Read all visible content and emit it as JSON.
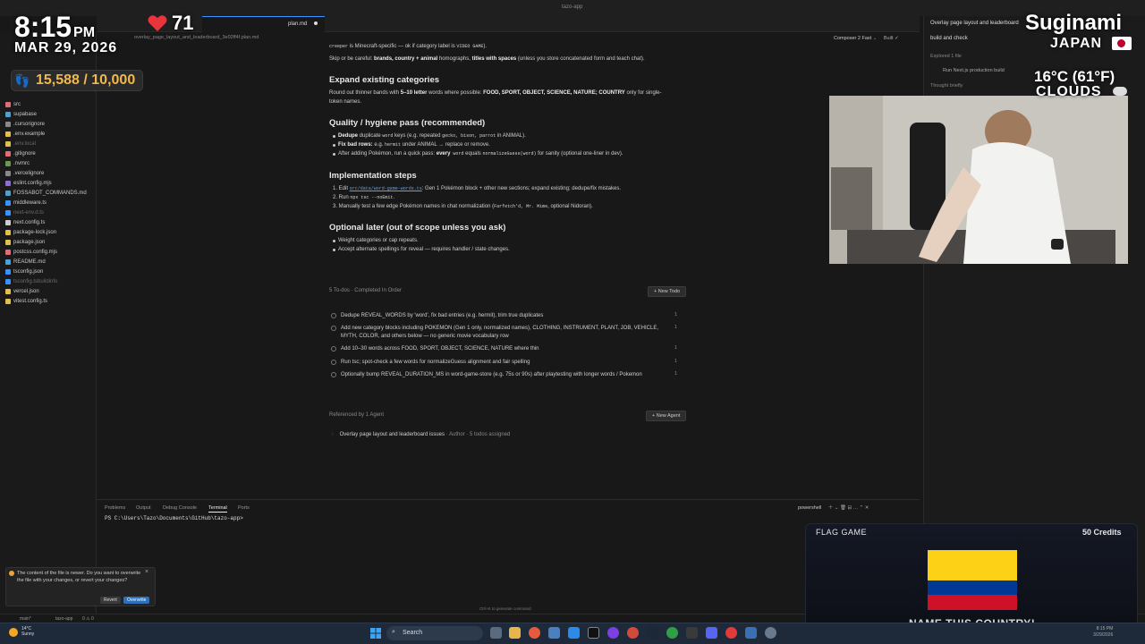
{
  "window": {
    "title": "tazo-app"
  },
  "tab": {
    "label": "plan.md",
    "path": "overlay_page_layout_and_leaderboard_3e02ff4f.plan.md"
  },
  "overlay": {
    "time": "8:15",
    "ampm": "PM",
    "date": "MAR 29, 2026",
    "heart_rate": "71",
    "steps": "15,588 / 10,000",
    "city": "Suginami",
    "country": "JAPAN",
    "temperature": "16°C (61°F)",
    "condition": "CLOUDS"
  },
  "explorer": {
    "items": [
      {
        "name": "src",
        "color": "#e06c75",
        "muted": false
      },
      {
        "name": "supabase",
        "color": "#4ea1d3",
        "muted": false
      },
      {
        "name": ".cursorignore",
        "color": "#888",
        "muted": false
      },
      {
        "name": ".env.example",
        "color": "#e0c14e",
        "muted": false
      },
      {
        "name": ".env.local",
        "color": "#e0c14e",
        "muted": true
      },
      {
        "name": ".gitignore",
        "color": "#e06c75",
        "muted": false
      },
      {
        "name": ".nvmrc",
        "color": "#6a9955",
        "muted": false
      },
      {
        "name": ".vercelignore",
        "color": "#888",
        "muted": false
      },
      {
        "name": "eslint.config.mjs",
        "color": "#8f6cd8",
        "muted": false
      },
      {
        "name": "FOSSABOT_COMMANDS.md",
        "color": "#4ea1d3",
        "muted": false
      },
      {
        "name": "middleware.ts",
        "color": "#3794ff",
        "muted": false
      },
      {
        "name": "next-env.d.ts",
        "color": "#3794ff",
        "muted": true
      },
      {
        "name": "next.config.ts",
        "color": "#cccccc",
        "muted": false
      },
      {
        "name": "package-lock.json",
        "color": "#e0c14e",
        "muted": false
      },
      {
        "name": "package.json",
        "color": "#e0c14e",
        "muted": false
      },
      {
        "name": "postcss.config.mjs",
        "color": "#e06c75",
        "muted": false
      },
      {
        "name": "README.md",
        "color": "#4ea1d3",
        "muted": false
      },
      {
        "name": "tsconfig.json",
        "color": "#3794ff",
        "muted": false
      },
      {
        "name": "tsconfig.tsbuildinfo",
        "color": "#3794ff",
        "muted": true
      },
      {
        "name": "vercel.json",
        "color": "#e0c14e",
        "muted": false
      },
      {
        "name": "vitest.config.ts",
        "color": "#e0c14e",
        "muted": false
      }
    ]
  },
  "doc": {
    "line1_code": "creeper",
    "line1_rest": " is Minecraft-specific — ok if category label is ",
    "line1_code2": "VIDEO GAME",
    "line1_end": ").",
    "line2_a": "Skip or be careful: ",
    "line2_b": "brands, country + animal",
    "line2_c": " homographs, ",
    "line2_d": "titles with spaces",
    "line2_e": " (unless you store concatenated form and teach chat).",
    "h_expand": "Expand existing categories",
    "expand_a": "Round out thinner bands with ",
    "expand_b": "5–10 letter",
    "expand_c": " words where possible: ",
    "expand_d": "FOOD, SPORT, OBJECT, SCIENCE, NATURE; COUNTRY",
    "expand_e": " only for single-",
    "expand_f": "token names.",
    "h_quality": "Quality / hygiene pass (recommended)",
    "q1_a": "Dedupe",
    "q1_b": " duplicate ",
    "q1_c": "word",
    "q1_d": " keys (e.g. repeated ",
    "q1_e": "gecko, bison, parrot",
    "q1_f": " in ANIMAL).",
    "q2_a": "Fix bad rows:",
    "q2_b": " e.g. ",
    "q2_c": "hermit",
    "q2_d": " under ANIMAL → replace or remove.",
    "q3_a": "After adding Pokémon, run a quick pass: ",
    "q3_b": "every",
    "q3_c": " word",
    "q3_d": " equals ",
    "q3_e": "normalizeGuess(word)",
    "q3_f": " for sanity (optional one-liner in dev).",
    "h_impl": "Implementation steps",
    "i1_a": "Edit ",
    "i1_link": "src/data/word-game-words.ts",
    "i1_b": ": Gen 1 Pokémon block + other new sections; expand existing; dedupe/fix mistakes.",
    "i2_a": "Run ",
    "i2_code": "npx tsc --noEmit",
    "i2_b": ".",
    "i3_a": "Manually test a few edge Pokémon names in chat normalization (",
    "i3_code": "Farfetch'd, Mr. Mime",
    "i3_b": ", optional Nidoran).",
    "h_optional": "Optional later (out of scope unless you ask)",
    "o1": "Weight categories or cap repeats.",
    "o2": "Accept alternate spellings for reveal — requires handler / state changes."
  },
  "todos": {
    "header": "5 To-dos · Completed In Order",
    "new_label": "New Todo",
    "items": [
      {
        "text": "Dedupe REVEAL_WORDS by 'word', fix bad entries (e.g. hermit), trim true duplicates",
        "count": "1"
      },
      {
        "text": "Add new category blocks including POKEMON (Gen 1 only, normalized names), CLOTHING, INSTRUMENT, PLANT, JOB, VEHICLE, MYTH, COLOR, and others below — no generic movie vocabulary row",
        "count": "1"
      },
      {
        "text": "Add 10–30 words across FOOD, SPORT, OBJECT, SCIENCE, NATURE where thin",
        "count": "1"
      },
      {
        "text": "Run tsc; spot-check a few words for normalizeGuess alignment and fair spelling",
        "count": "1"
      },
      {
        "text": "Optionally bump REVEAL_DURATION_MS in word-game-store (e.g. 75s or 90s) after playtesting with longer words / Pokemon",
        "count": "1"
      }
    ]
  },
  "referenced": {
    "header": "Referenced by 1 Agent",
    "new_label": "New Agent",
    "item": "Overlay page layout and leaderboard issues",
    "meta": " · Author · 5 todos assigned"
  },
  "panel": {
    "tabs": [
      "Problems",
      "Output",
      "Debug Console",
      "Terminal",
      "Ports"
    ],
    "active_tab": "Terminal",
    "shell": "powershell",
    "prompt": "PS C:\\Users\\Tazo\\Documents\\GitHub\\tazo-app>",
    "hint": "Ctrl+K to generate command"
  },
  "notification": {
    "text": "The content of the file is newer. Do you want to overwrite the file with your changes, or revert your changes?",
    "revert": "Revert",
    "overwrite": "Overwrite"
  },
  "chat": {
    "title": "Overlay page layout and leaderboard",
    "input": "build and check",
    "explored": "Explored 1 file",
    "run": "Run Next.js production build",
    "thought": "Thought briefly",
    "composer": "Composer 2 Fast",
    "built": "Built"
  },
  "statusbar": {
    "branch": "main*",
    "project": "tazo-app",
    "problems": "0 ⚠ 0"
  },
  "flaggame": {
    "title": "FLAG GAME",
    "credits": "50 Credits",
    "prompt": "NAME THIS COUNTRY!",
    "flag_colors": [
      "#fcd116",
      "#003893",
      "#ce1126"
    ]
  },
  "taskbar": {
    "search": "Search",
    "weather_temp": "14°C",
    "weather_cond": "Sunny",
    "clock_time": "8:15 PM",
    "clock_date": "3/29/2026"
  }
}
